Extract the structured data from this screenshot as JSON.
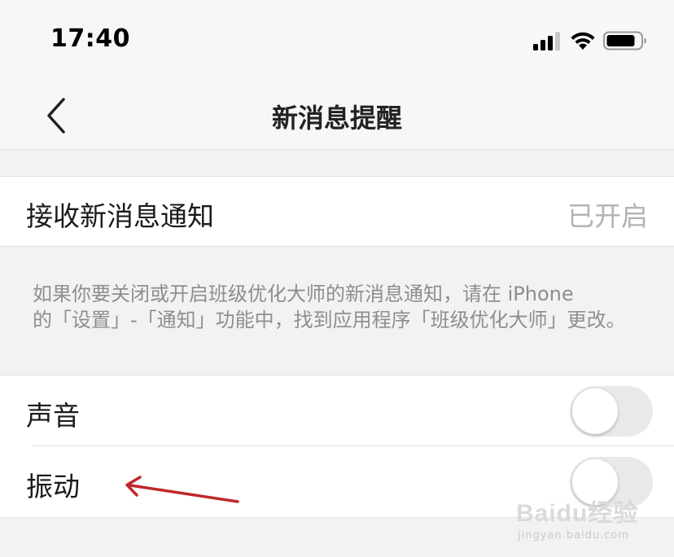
{
  "status_bar": {
    "time": "17:40",
    "icons": [
      "signal-icon",
      "wifi-icon",
      "battery-icon"
    ]
  },
  "nav": {
    "back_icon": "chevron-left-icon",
    "title": "新消息提醒"
  },
  "notify": {
    "label": "接收新消息通知",
    "value": "已开启"
  },
  "description": {
    "line1": "如果你要关闭或开启班级优化大师的新消息通知，请在 iPhone",
    "line2": "的「设置」-「通知」功能中，找到应用程序「班级优化大师」更改。"
  },
  "settings": [
    {
      "label": "声音",
      "enabled": false
    },
    {
      "label": "振动",
      "enabled": false
    }
  ],
  "annotation": {
    "icon": "red-arrow-icon",
    "color": "#c0282b"
  },
  "watermark": {
    "logo": "Baidu经验",
    "url": "jingyan.baidu.com"
  },
  "colors": {
    "background": "#f2f2f2",
    "cell": "#ffffff",
    "value_text": "#b3b3b3",
    "toggle_off": "#e9e9eb"
  }
}
